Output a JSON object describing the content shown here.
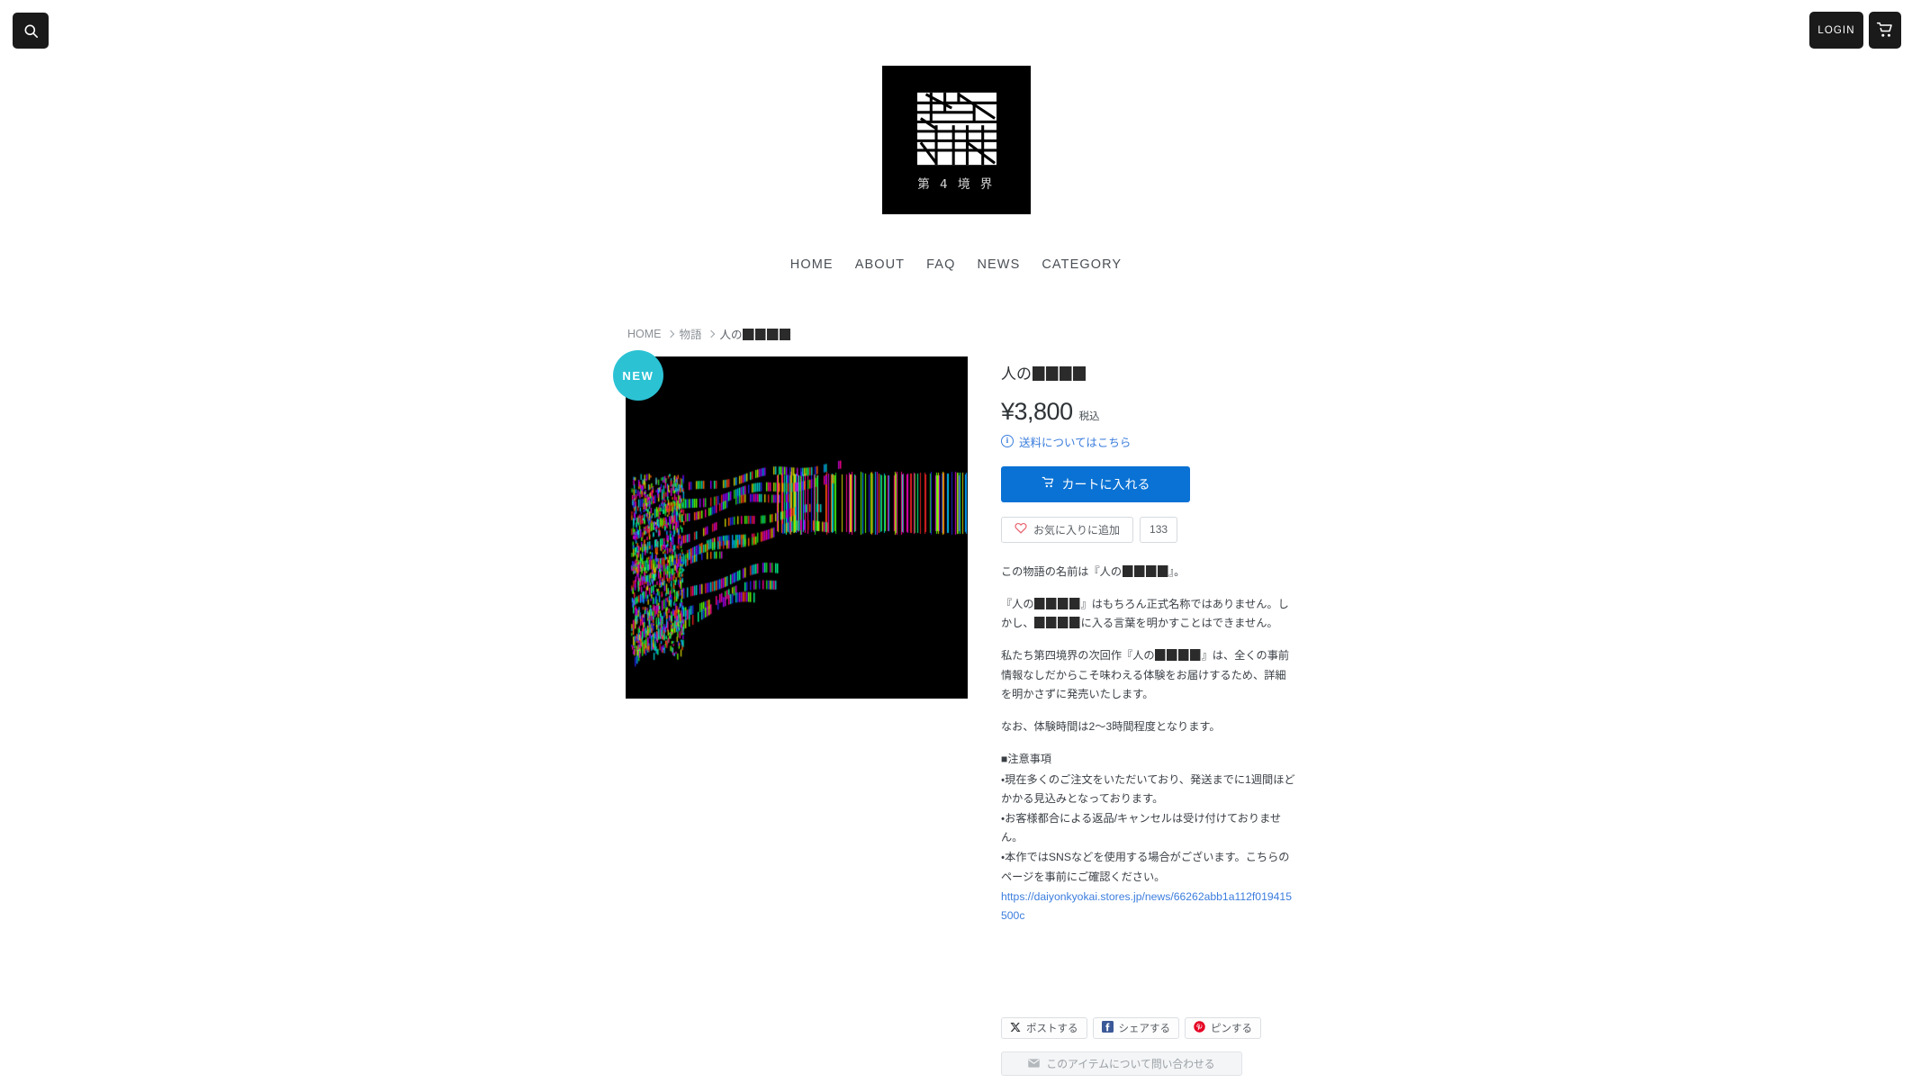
{
  "header": {
    "search_label": "search-icon",
    "login_label": "LOGIN",
    "cart_label": "cart-icon"
  },
  "logo": {
    "sub_text": "第 4 境 界",
    "alt": "第4境界"
  },
  "nav": {
    "items": [
      {
        "label": "HOME"
      },
      {
        "label": "ABOUT"
      },
      {
        "label": "FAQ"
      },
      {
        "label": "NEWS"
      },
      {
        "label": "CATEGORY"
      }
    ]
  },
  "breadcrumb": {
    "home": "HOME",
    "category": "物語",
    "current_prefix": "人の",
    "current_redacted_blocks": 4
  },
  "product": {
    "badge": "NEW",
    "title_prefix": "人の",
    "title_redacted_blocks": 4,
    "price": "¥3,800",
    "tax_label": "税込",
    "shipping_link": "送料についてはこちら",
    "add_to_cart": "カートに入れる",
    "favorite_label": "お気に入りに追加",
    "favorite_count": "133",
    "image_alt": "glitch-artwork-black-background-color-stripes"
  },
  "description": {
    "p1_a": "この物語の名前は『人の",
    "p1_b": "』。",
    "p2_a": "『人の",
    "p2_b": "』はもちろん正式名称ではありません。しかし、",
    "p2_c": "に入る言葉を明かすことはできません。",
    "p3_a": "私たち第四境界の次回作『人の",
    "p3_b": "』は、全くの事前情報なしだからこそ味わえる体験をお届けするため、詳細を明かさずに発売いたします。",
    "p4": "なお、体験時間は2〜3時間程度となります。",
    "notice_heading": "■注意事項",
    "notice_1": "・現在多くのご注文をいただいており、発送までに1週間ほどかかる見込みとなっております。",
    "notice_2": "・お客様都合による返品/キャンセルは受け付けておりません。",
    "notice_3": "・本作ではSNSなどを使用する場合がございます。こちらのページを事前にご確認ください。",
    "notice_url": "https://daiyonkyokai.stores.jp/news/66262abb1a112f019415500c"
  },
  "share": {
    "twitter": "ポストする",
    "facebook": "シェアする",
    "pinterest": "ピンする",
    "contact": "このアイテムについて問い合わせる"
  },
  "colors": {
    "accent_blue": "#0a72d4",
    "link_blue": "#3b7ddd",
    "badge_teal": "#2bc2d4",
    "dark": "#1a1a1a",
    "heart_red": "#e8616d",
    "facebook_blue": "#3b5998",
    "pinterest_red": "#e60023"
  }
}
